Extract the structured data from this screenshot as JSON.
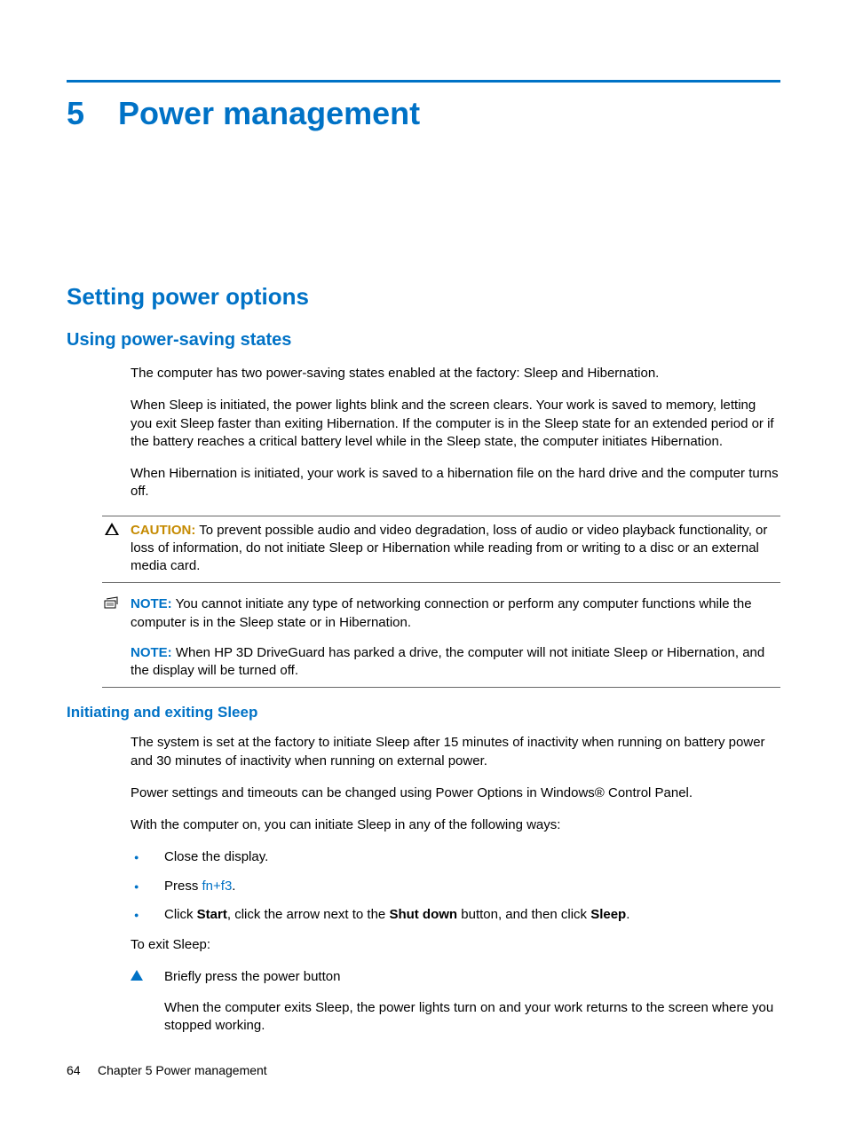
{
  "chapter": {
    "number": "5",
    "title": "Power management"
  },
  "section": {
    "h2": "Setting power options",
    "h3": "Using power-saving states",
    "p1": "The computer has two power-saving states enabled at the factory: Sleep and Hibernation.",
    "p2": "When Sleep is initiated, the power lights blink and the screen clears. Your work is saved to memory, letting you exit Sleep faster than exiting Hibernation. If the computer is in the Sleep state for an extended period or if the battery reaches a critical battery level while in the Sleep state, the computer initiates Hibernation.",
    "p3": "When Hibernation is initiated, your work is saved to a hibernation file on the hard drive and the computer turns off."
  },
  "caution": {
    "label": "CAUTION:",
    "text": "To prevent possible audio and video degradation, loss of audio or video playback functionality, or loss of information, do not initiate Sleep or Hibernation while reading from or writing to a disc or an external media card."
  },
  "note1": {
    "label": "NOTE:",
    "text": "You cannot initiate any type of networking connection or perform any computer functions while the computer is in the Sleep state or in Hibernation.",
    "label2": "NOTE:",
    "text2": "When HP 3D DriveGuard has parked a drive, the computer will not initiate Sleep or Hibernation, and the display will be turned off."
  },
  "sleep": {
    "h4": "Initiating and exiting Sleep",
    "p1": "The system is set at the factory to initiate Sleep after 15 minutes of inactivity when running on battery power and 30 minutes of inactivity when running on external power.",
    "p2": "Power settings and timeouts can be changed using Power Options in Windows® Control Panel.",
    "p3": "With the computer on, you can initiate Sleep in any of the following ways:",
    "b1": "Close the display.",
    "b2a": "Press ",
    "b2b": "fn+f3",
    "b2c": ".",
    "b3a": "Click ",
    "b3b": "Start",
    "b3c": ", click the arrow next to the ",
    "b3d": "Shut down",
    "b3e": " button, and then click ",
    "b3f": "Sleep",
    "b3g": ".",
    "p4": "To exit Sleep:",
    "step1": "Briefly press the power button",
    "p5": "When the computer exits Sleep, the power lights turn on and your work returns to the screen where you stopped working."
  },
  "footer": {
    "page": "64",
    "label": "Chapter 5   Power management"
  }
}
